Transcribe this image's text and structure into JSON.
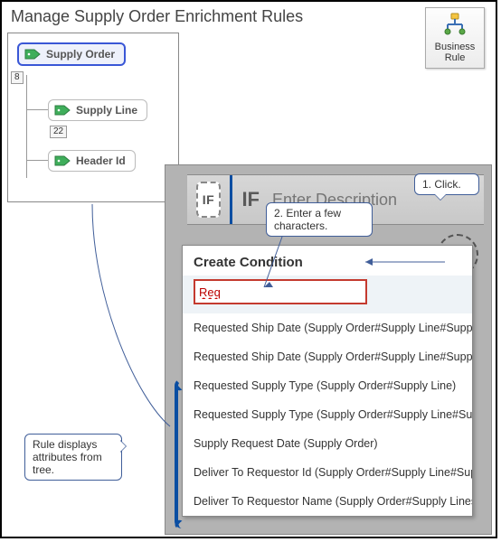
{
  "title": "Manage Supply Order Enrichment Rules",
  "business_rule": {
    "line1": "Business",
    "line2": "Rule"
  },
  "tree": {
    "root": {
      "label": "Supply Order",
      "count": "8"
    },
    "children": [
      {
        "label": "Supply Line",
        "count": "22"
      },
      {
        "label": "Header Id"
      }
    ]
  },
  "rule": {
    "if_chip": "IF",
    "if_label": "IF",
    "desc_placeholder": "Enter Description",
    "create_condition_title": "Create Condition",
    "search_value": "Req",
    "suggestions": [
      "Requested Ship Date (Supply Order#Supply Line#Supp",
      "Requested Ship Date (Supply Order#Supply Line#Supp",
      "Requested Supply Type (Supply Order#Supply Line)",
      "Requested Supply Type (Supply Order#Supply Line#Su",
      "Supply Request Date (Supply Order)",
      "Deliver To Requestor Id (Supply Order#Supply Line#Sup",
      "Deliver To Requestor Name (Supply Order#Supply Lines"
    ]
  },
  "callouts": {
    "c1": "1. Click.",
    "c2": "2. Enter a few characters.",
    "c3": "Rule displays attributes from tree."
  }
}
